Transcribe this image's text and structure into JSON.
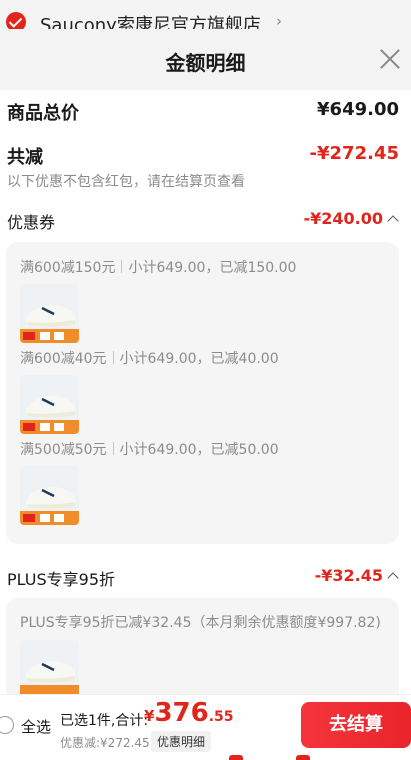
{
  "store": {
    "name": "Saucony索康尼官方旗舰店",
    "chevron": "›"
  },
  "sheet": {
    "title": "金额明细",
    "goods_total": {
      "label": "商品总价",
      "value": "¥649.00"
    },
    "total_reduction": {
      "label": "共减",
      "value": "-¥272.45",
      "note": "以下优惠不包含红包，请在结算页查看"
    },
    "coupon": {
      "label": "优惠券",
      "value": "-¥240.00",
      "items": [
        {
          "rule": "满600减150元",
          "detail": "小计649.00，已减150.00"
        },
        {
          "rule": "满600减40元",
          "detail": "小计649.00，已减40.00"
        },
        {
          "rule": "满500减50元",
          "detail": "小计649.00，已减50.00"
        }
      ]
    },
    "plus": {
      "label": "PLUS专享95折",
      "value": "-¥32.45",
      "detail": "PLUS专享95折已减¥32.45（本月剩余优惠额度¥997.82)"
    }
  },
  "bottom": {
    "select_all": "全选",
    "selected": "已选1件,合计:",
    "total_currency": "¥",
    "total_integer": "376",
    "total_decimal": ".55",
    "discount": "优惠减:¥272.45",
    "detail_tag": "优惠明细",
    "checkout": "去结算"
  },
  "colors": {
    "accent": "#e1251b",
    "header_bg": "#f3f3f3",
    "card_bg": "#f5f5f5"
  }
}
